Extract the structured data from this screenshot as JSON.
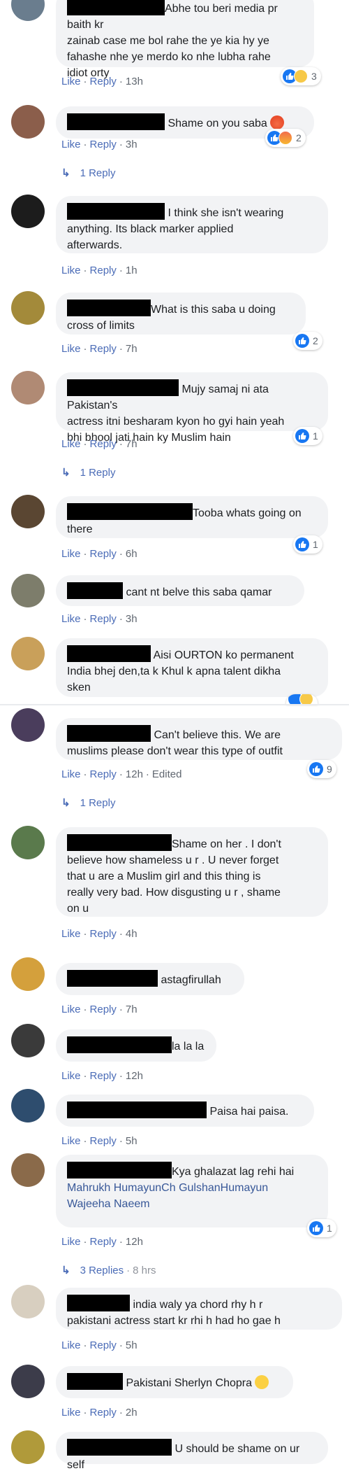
{
  "actions": {
    "like": "Like",
    "reply": "Reply",
    "edited": "Edited"
  },
  "comments": [
    {
      "text": "Abhe tou beri media pr baith kr\nzainab case me bol rahe the ye kia hy ye\nfahashe nhe ye merdo ko nhe lubha rahe\nidiot orty",
      "time": "13h",
      "reactions": "3"
    },
    {
      "text": "Shame on you saba",
      "time": "3h",
      "reactions": "2",
      "replies": "1 Reply"
    },
    {
      "text": "I think she isn't wearing\nanything. Its black marker applied\nafterwards.",
      "time": "1h"
    },
    {
      "text": "What is this saba u doing\ncross of limits",
      "time": "7h",
      "reactions": "2"
    },
    {
      "text": "Mujy samaj ni ata Pakistan's\nactress itni besharam kyon ho gyi hain yeah\nbhi bhool jati hain ky Muslim hain",
      "time": "7h",
      "reactions": "1",
      "replies": "1 Reply"
    },
    {
      "text": "Tooba whats going on\nthere",
      "time": "6h",
      "reactions": "1"
    },
    {
      "text": "cant nt belve this saba qamar",
      "time": "3h"
    },
    {
      "text": "Aisi OURTON ko permanent\nIndia bhej den,ta k Khul k apna talent dikha\nsken"
    },
    {
      "text": "Can't believe this. We are\nmuslims please don't wear this type of outfit",
      "time": "12h",
      "reactions": "9",
      "replies": "1 Reply"
    },
    {
      "text": "Shame on her . I don't\nbelieve how shameless u r . U never forget\nthat u are a Muslim girl and this thing is\nreally very bad. How disgusting u r , shame\non u",
      "time": "4h"
    },
    {
      "text": "astagfirullah",
      "time": "7h"
    },
    {
      "text": "la la la",
      "time": "12h"
    },
    {
      "text": "Paisa hai paisa.",
      "time": "5h"
    },
    {
      "text": "Kya ghalazat lag rehi hai",
      "tags": [
        "Mahrukh Humayun",
        "Ch Gulshan",
        "Humayun\nWajeeha Naeem"
      ],
      "time": "12h",
      "reactions": "1",
      "replies": "3 Replies",
      "replies_time": "8 hrs"
    },
    {
      "text": "india waly ya chord rhy h r\npakistani actress start kr rhi h had ho gae h",
      "time": "5h"
    },
    {
      "text": "Pakistani Sherlyn Chopra",
      "time": "2h"
    },
    {
      "text": "U should be shame on ur self"
    }
  ],
  "colors": {
    "link": "#4b6cb7",
    "bubble": "#f2f3f5",
    "like_blue": "#1877f2"
  }
}
